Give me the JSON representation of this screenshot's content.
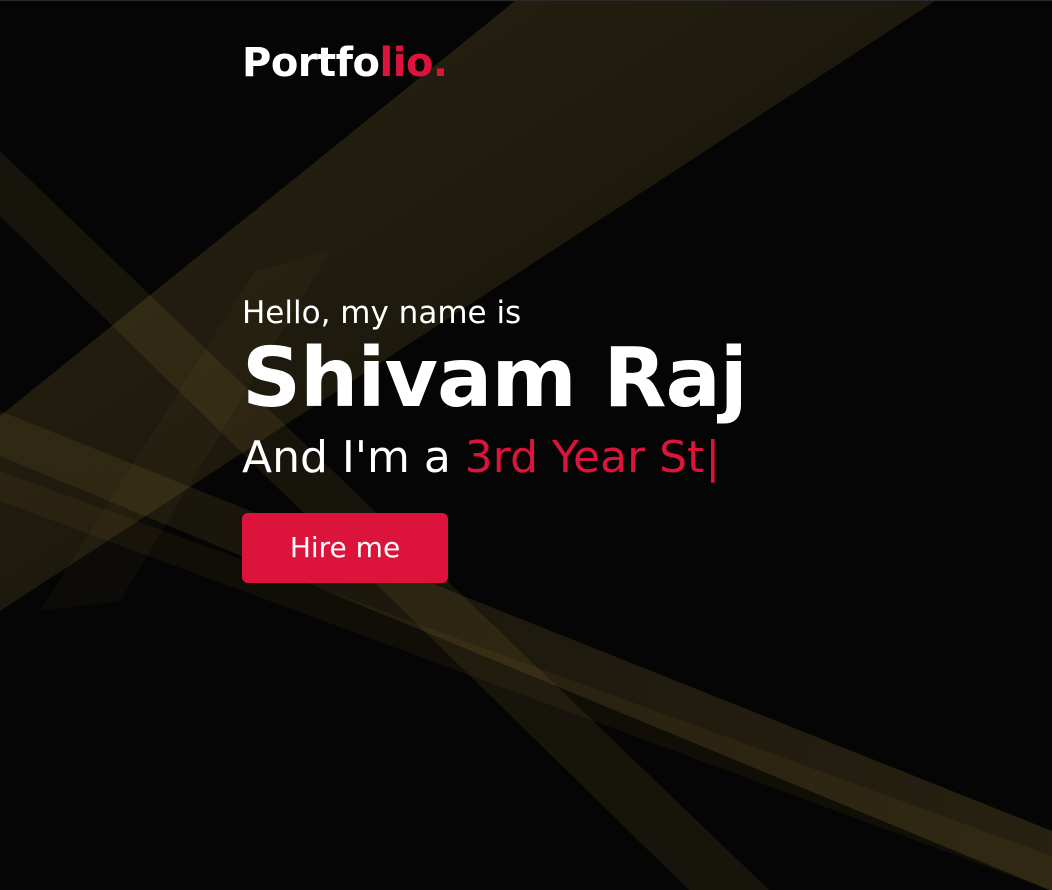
{
  "header": {
    "logo_main": "Portfo",
    "logo_accent": "lio."
  },
  "hero": {
    "greeting": "Hello, my name is",
    "name": "Shivam Raj",
    "role_prefix": "And I'm a",
    "role_typed": "3rd Year St",
    "cursor": "|",
    "cta_label": "Hire me"
  },
  "colors": {
    "background": "#050505",
    "accent": "#dc143c",
    "text": "#ffffff",
    "light_streaks": "#d6b24a"
  }
}
